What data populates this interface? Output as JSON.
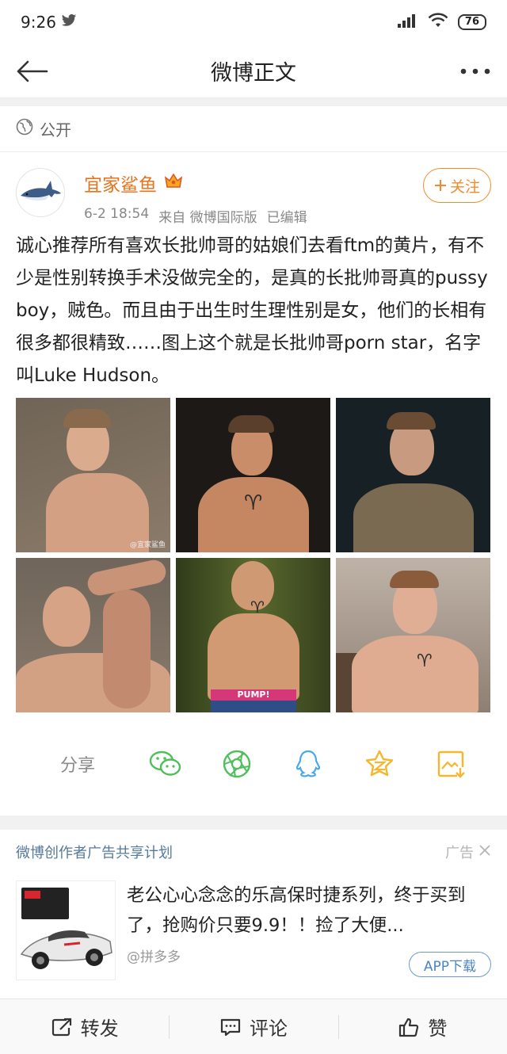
{
  "status_bar": {
    "time": "9:26",
    "battery": "76"
  },
  "nav": {
    "title": "微博正文"
  },
  "visibility": {
    "label": "公开"
  },
  "post": {
    "author": "宜家鲨鱼",
    "date": "6-2 18:54",
    "source": "来自 微博国际版",
    "edited": "已编辑",
    "follow_label": "关注",
    "text": "诚心推荐所有喜欢长批帅哥的姑娘们去看ftm的黄片，有不少是性别转换手术没做完全的，是真的长批帅哥真的pussy boy，贼色。而且由于出生时生理性别是女，他们的长相有很多都很精致……图上这个就是长批帅哥porn star，名字叫Luke Hudson。",
    "photos": [
      {
        "name": "photo-1",
        "bg": "#7f705f",
        "skin": "#d9a689",
        "watermark": "@宜家鲨鱼"
      },
      {
        "name": "photo-2",
        "bg": "#1e1a17",
        "skin": "#c98b67",
        "tattoo": "♈"
      },
      {
        "name": "photo-3",
        "bg": "#1b2326",
        "skin": "#c99a82",
        "shirt": "#7a6a52"
      },
      {
        "name": "photo-4",
        "bg": "#7a6b5f",
        "skin": "#d6a285"
      },
      {
        "name": "photo-5",
        "bg": "#3f4a24",
        "skin": "#d29a72",
        "tattoo": "♈",
        "waistband": "PUMP!"
      },
      {
        "name": "photo-6",
        "bg": "#a39488",
        "skin": "#e0ad93",
        "tattoo": "♈"
      }
    ]
  },
  "share": {
    "label": "分享",
    "targets": [
      "wechat-icon",
      "moments-icon",
      "qq-icon",
      "qzone-icon",
      "save-image-icon"
    ]
  },
  "ad": {
    "program": "微博创作者广告共享计划",
    "tag": "广告",
    "text": "老公心心念念的乐高保时捷系列，终于买到了，抢购价只要9.9！！捡了大便...",
    "source": "@拼多多",
    "button": "APP下载"
  },
  "actions": {
    "repost": "转发",
    "comment": "评论",
    "like": "赞"
  },
  "colors": {
    "accent_orange": "#f28c2a",
    "link_blue": "#567a9c",
    "wechat_green": "#4fbf5a",
    "qq_blue": "#4aa9e8",
    "qzone_yellow": "#f4b72e"
  }
}
